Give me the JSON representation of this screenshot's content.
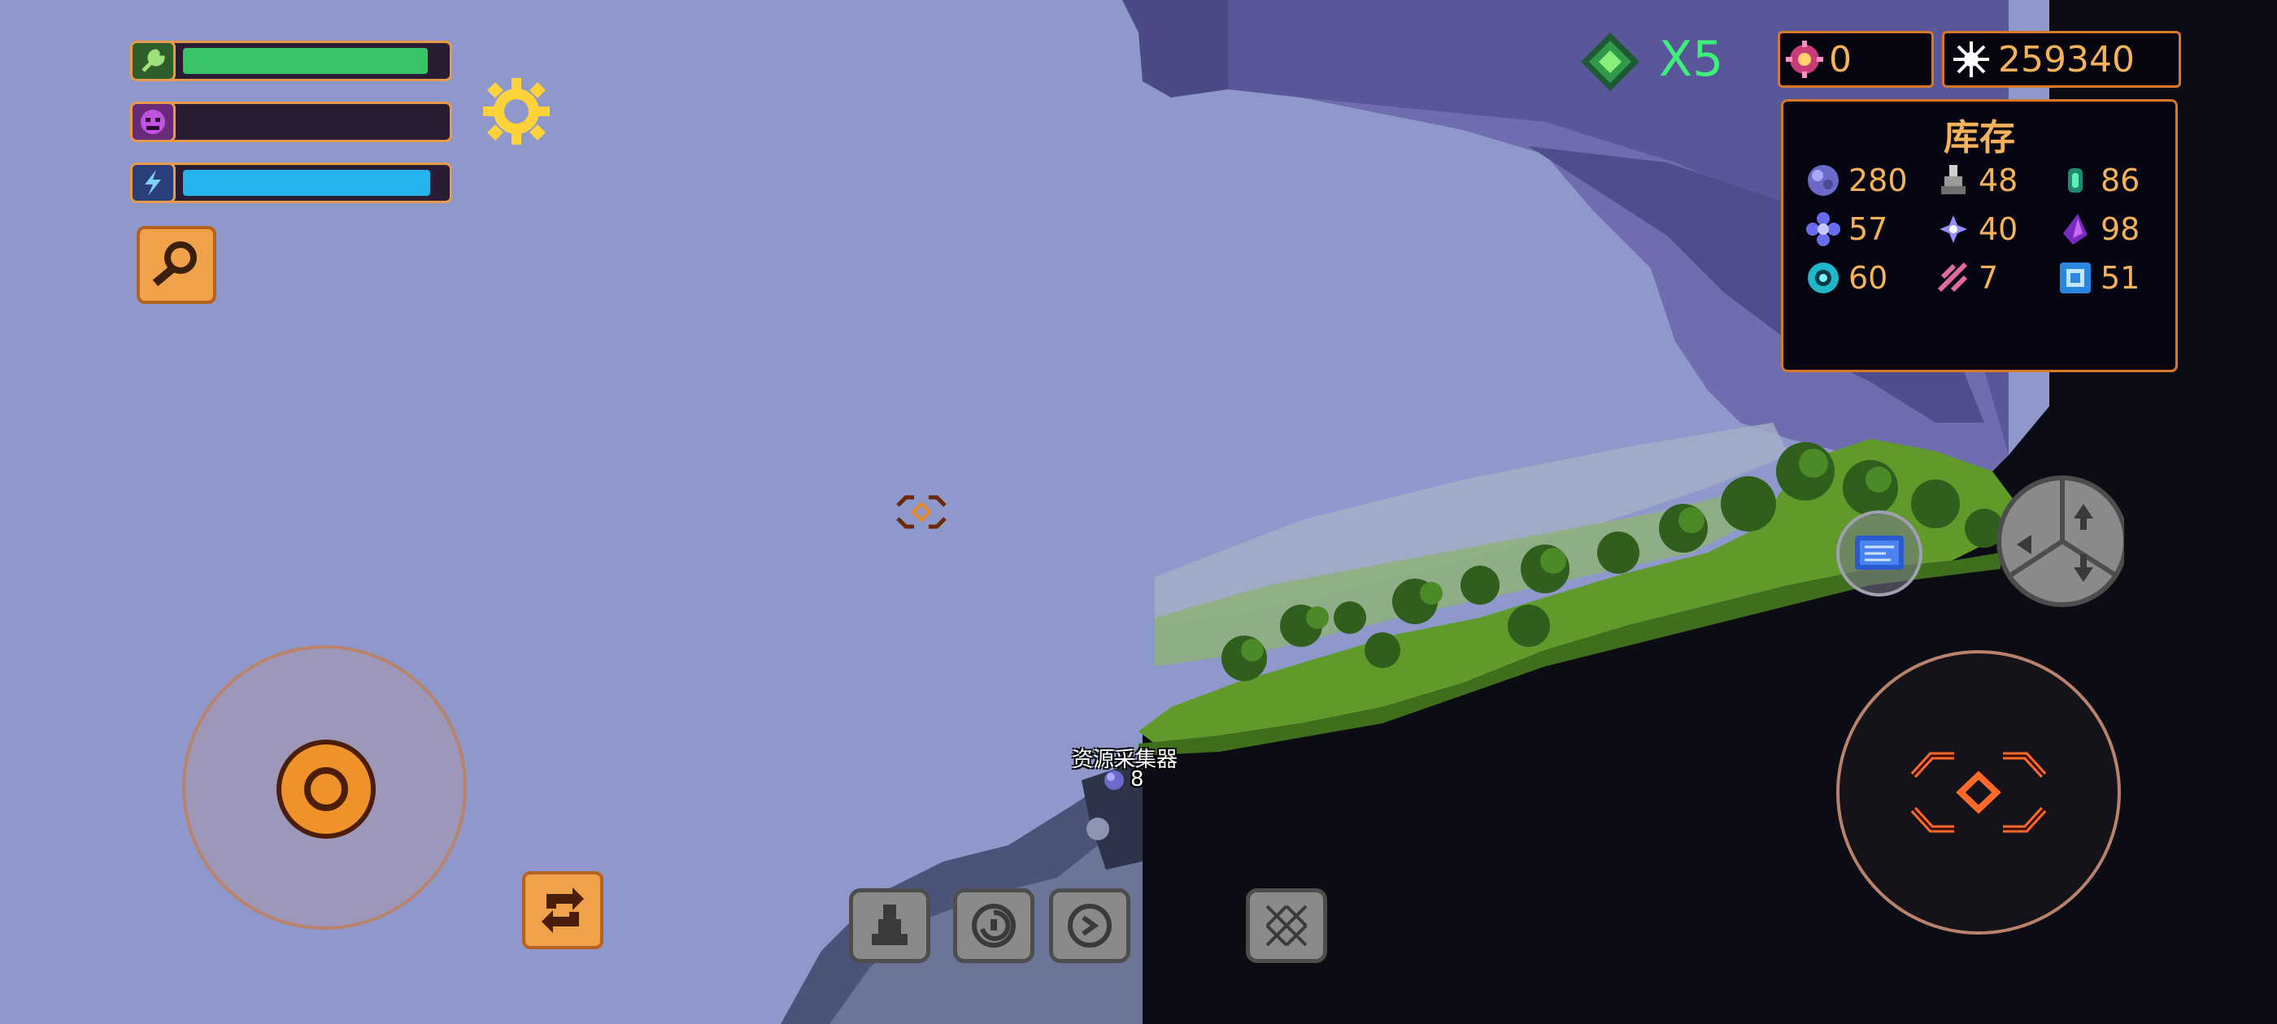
{
  "hud": {
    "multiplier_text": "X5",
    "currency_a": "0",
    "currency_b": "259340"
  },
  "inventory": {
    "title": "库存",
    "items": [
      {
        "icon": "purple-crystal-icon",
        "count": "280"
      },
      {
        "icon": "grey-ore-icon",
        "count": "48"
      },
      {
        "icon": "teal-gem-icon",
        "count": "86"
      },
      {
        "icon": "blue-flower-icon",
        "count": "57"
      },
      {
        "icon": "star-shard-icon",
        "count": "40"
      },
      {
        "icon": "violet-shard-icon",
        "count": "98"
      },
      {
        "icon": "cyan-gear-icon",
        "count": "60"
      },
      {
        "icon": "pink-fiber-icon",
        "count": "7"
      },
      {
        "icon": "blue-cube-icon",
        "count": "51"
      }
    ]
  },
  "world_label": {
    "name": "资源采集器",
    "count": "8"
  },
  "stats": {
    "health_level": 0.94,
    "rage_level": 0.0,
    "energy_level": 0.95
  },
  "colors": {
    "sky": "#8f98cb",
    "accent_orange": "#f0a24a",
    "panel_text": "#f5b25a",
    "health_green": "#3ac46a",
    "energy_blue": "#23b4ef"
  }
}
